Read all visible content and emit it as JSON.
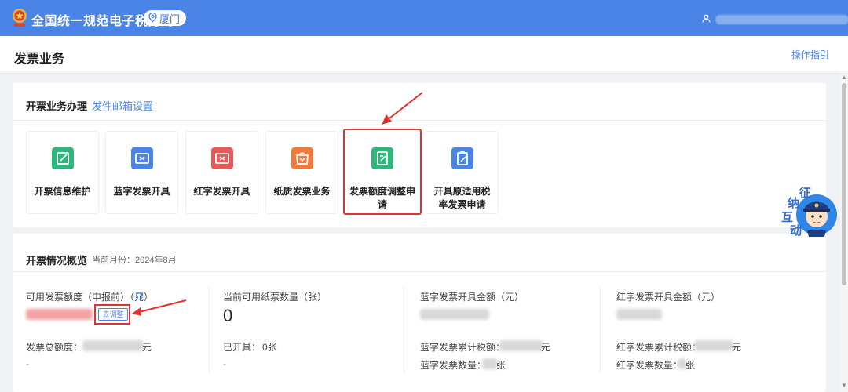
{
  "header": {
    "app_title": "全国统一规范电子税务局",
    "city": "厦门"
  },
  "page": {
    "title": "发票业务",
    "guide_link": "操作指引"
  },
  "business": {
    "title": "开票业务办理",
    "mail_link": "发件邮箱设置",
    "tiles": [
      {
        "label": "开票信息维护",
        "color": "#2fb67a"
      },
      {
        "label": "蓝字发票开具",
        "color": "#4a84e6"
      },
      {
        "label": "红字发票开具",
        "color": "#e65a5a"
      },
      {
        "label": "纸质发票业务",
        "color": "#f07a3a"
      },
      {
        "label": "发票额度调整申请",
        "color": "#2fb67a"
      },
      {
        "label": "开具原适用税率发票申请",
        "color": "#4a84e6"
      }
    ]
  },
  "overview": {
    "title": "开票情况概览",
    "month": "当前月份：2024年8月",
    "available_quota_label": "可用发票额度（申报前）（元）",
    "adjust_button": "去调整",
    "total_quota_label": "发票总额度：",
    "yuan": "元",
    "dash": "-",
    "paper_count_label": "当前可用纸票数量（张）",
    "paper_count_value": "0",
    "issued_label": "已开具：",
    "issued_value": "0张",
    "blue_amount_label": "蓝字发票开具金额（元）",
    "blue_tax_label": "蓝字发票累计税额：",
    "blue_count_label": "蓝字发票数量：",
    "red_amount_label": "红字发票开具金额（元）",
    "red_tax_label": "红字发票累计税额：",
    "red_count_label": "红字发票数量：",
    "zhang": "张"
  },
  "mascot": {
    "lines": [
      "征",
      "纳",
      "互",
      "动"
    ]
  },
  "colors": {
    "brand": "#4a84e6",
    "highlight": "#e6302e"
  }
}
